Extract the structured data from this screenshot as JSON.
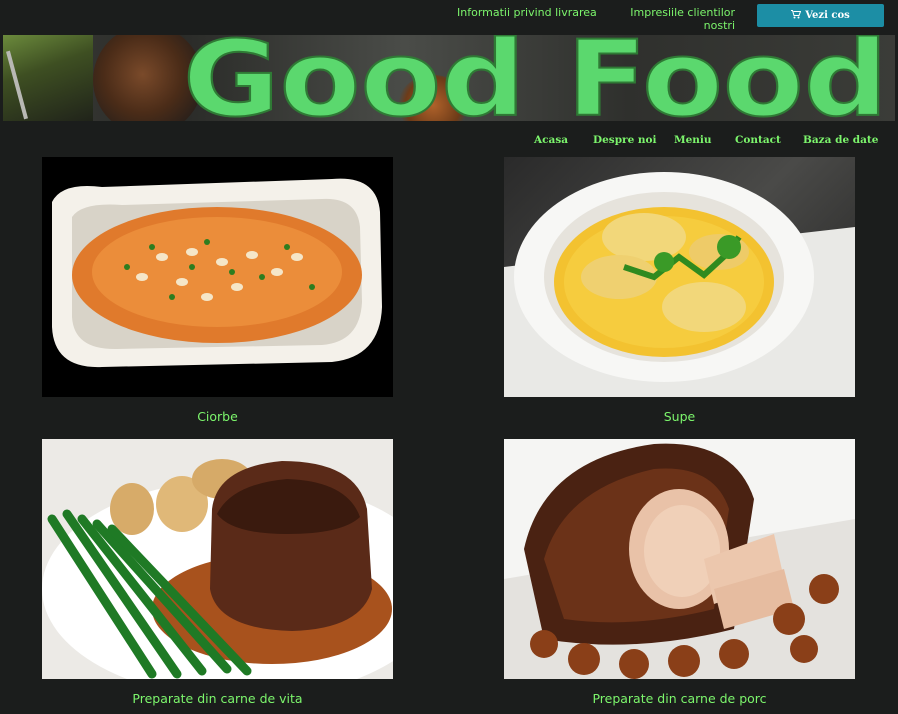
{
  "header": {
    "delivery_link": "Informatii privind livrarea",
    "reviews_link": "Impresiile clientilor nostri",
    "cart_button": "Vezi cos",
    "cart_icon": "shopping-cart-icon"
  },
  "banner": {
    "title": "Good Food"
  },
  "nav": {
    "items": [
      {
        "label": "Acasa"
      },
      {
        "label": "Despre noi"
      },
      {
        "label": "Meniu"
      },
      {
        "label": "Contact"
      },
      {
        "label": "Baza de date"
      }
    ]
  },
  "categories": [
    {
      "label": "Ciorbe"
    },
    {
      "label": "Supe"
    },
    {
      "label": "Preparate din carne de vita"
    },
    {
      "label": "Preparate din carne de porc"
    }
  ],
  "colors": {
    "accent_text": "#7cf56c",
    "button_bg": "#1c8ea5",
    "page_bg": "#1b1d1c"
  }
}
